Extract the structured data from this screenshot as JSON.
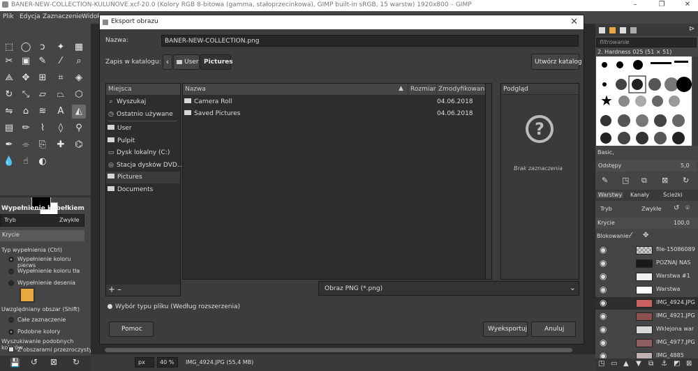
{
  "window": {
    "title": "BANER-NEW-COLLECTION-KULUNOVE.xcf-20.0 (Kolory RGB 8-bitowa (gamma, stałoprzecinkowa), GIMP built-in sRGB, 15 warstw) 1920x800 – GIMP",
    "minimize": "–",
    "restore": "❐",
    "close": "✕"
  },
  "menu": [
    "Plik",
    "Edycja",
    "Zaznaczenie",
    "Widok"
  ],
  "toolbox": {
    "options_title": "Wypełnienie kubełkiem",
    "mode_label": "Tryb",
    "mode_value": "Zwykłe",
    "opacity_label": "Krycie",
    "fill_type_label": "Typ wypełnienia  (Ctrl)",
    "fill_options": [
      "Wypełnienie koloru pierws",
      "Wypełnienie koloru tła",
      "Wypełnienie deseniа"
    ],
    "area_label": "Uwzględniany obszar  (Shift)",
    "area_options": [
      "Całe zaznaczenie",
      "Podobne kolory"
    ],
    "similar_label": "Wyszukiwanie podobnych kolorów",
    "transparent_option": "Z obszarami przezroczysty",
    "bottom_icons": [
      "save-icon",
      "restore-icon",
      "delete-icon",
      "reset-icon"
    ]
  },
  "dialog": {
    "title": "Eksport obrazu",
    "close": "✕",
    "name_label": "Nazwa:",
    "name_value": "BANER-NEW-COLLECTION.png",
    "save_in_label": "Zapis w katalogu:",
    "path": [
      "User",
      "Pictures"
    ],
    "create_folder": "Utwórz katalog",
    "places_header": "Miejsca",
    "places": [
      "Wyszukaj",
      "Ostatnio używane",
      "User",
      "Pulpit",
      "Dysk lokalny (C:)",
      "Stacja dysków DVD...",
      "Pictures",
      "Documents"
    ],
    "columns": {
      "name": "Nazwa",
      "size": "Rozmiar",
      "modified": "Zmodyfikowano"
    },
    "files": [
      {
        "name": "Camera Roll",
        "size": "",
        "modified": "04.06.2018"
      },
      {
        "name": "Saved Pictures",
        "size": "",
        "modified": "04.06.2018"
      }
    ],
    "preview_header": "Podgląd",
    "preview_empty": "Brak zaznaczenia",
    "add": "+",
    "remove": "–",
    "file_type": "Obraz PNG (*.png)",
    "select_type": "Wybór typu pliku (Według rozszerzenia)",
    "help": "Pomoc",
    "export": "Wyeksportuj",
    "cancel": "Anuluj"
  },
  "statusbar": {
    "unit": "px",
    "zoom": "40 %",
    "info": "IMG_4924.JPG (55,4 MB)"
  },
  "rightdock": {
    "filter_placeholder": "filtrowanie",
    "brush_name": "2. Hardness 025 (51 × 51)",
    "brush_set": "Basic,",
    "spacing_label": "Odstępy",
    "spacing_value": "5,0",
    "tabs": [
      "Warstwy",
      "Kanały",
      "Ścieżki"
    ],
    "mode_label": "Tryb",
    "mode_value": "Zwykłe",
    "opacity_label": "Krycie",
    "opacity_value": "100,0",
    "lock_label": "Blokowanie:",
    "layers": [
      {
        "name": "file-15086089",
        "thumb": "checker"
      },
      {
        "name": "POZNAJ NAS",
        "thumb": "#1a1a1a"
      },
      {
        "name": "Warstwa #1",
        "thumb": "#f0f0f0"
      },
      {
        "name": "Warstwa",
        "thumb": "#ffffff"
      },
      {
        "name": "IMG_4924.JPG",
        "thumb": "#c86060"
      },
      {
        "name": "IMG_4921.JPG",
        "thumb": "#8a5050"
      },
      {
        "name": "Wklejona war",
        "thumb": "#d8d8d8"
      },
      {
        "name": "IMG_4977.JPG",
        "thumb": "#906060"
      },
      {
        "name": "IMG_4885",
        "thumb": "#c0b0b0"
      }
    ]
  }
}
